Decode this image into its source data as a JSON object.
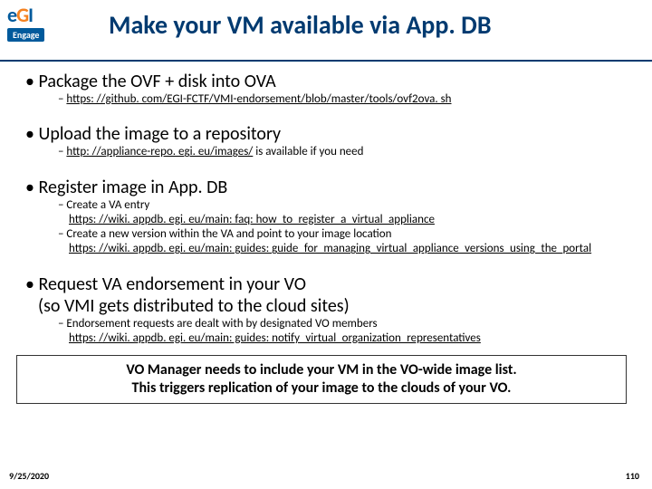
{
  "logo": {
    "text": "eGI",
    "sub": "Engage"
  },
  "title": "Make your VM available via App. DB",
  "bullets": {
    "b1": {
      "text": "Package the OVF + disk into OVA",
      "sub1": "https: //github. com/EGI-FCTF/VMI-endorsement/blob/master/tools/ovf2ova. sh"
    },
    "b2": {
      "text": "Upload the image to a repository",
      "sub1a": "http: //appliance-repo. egi. eu/images/",
      "sub1b": " is available if you need"
    },
    "b3": {
      "text": "Register image in App. DB",
      "sub1": "Create a VA entry",
      "sub1link": "https: //wiki. appdb. egi. eu/main: faq: how_to_register_a_virtual_appliance",
      "sub2": "Create a new version within the VA and point to your image location",
      "sub2link": "https: //wiki. appdb. egi. eu/main: guides: guide_for_managing_virtual_appliance_versions_using_the_portal"
    },
    "b4": {
      "line1": "Request VA endorsement in your VO",
      "line2": "(so VMI gets distributed to the cloud sites)",
      "sub1": "Endorsement requests are dealt with by designated VO members",
      "sub1link": "https: //wiki. appdb. egi. eu/main: guides: notify_virtual_organization_representatives"
    }
  },
  "callout": {
    "line1": "VO Manager needs to include your VM in the VO-wide image list.",
    "line2": "This triggers replication of your image to the clouds of your VO."
  },
  "footer": {
    "date": "9/25/2020",
    "page": "110"
  }
}
